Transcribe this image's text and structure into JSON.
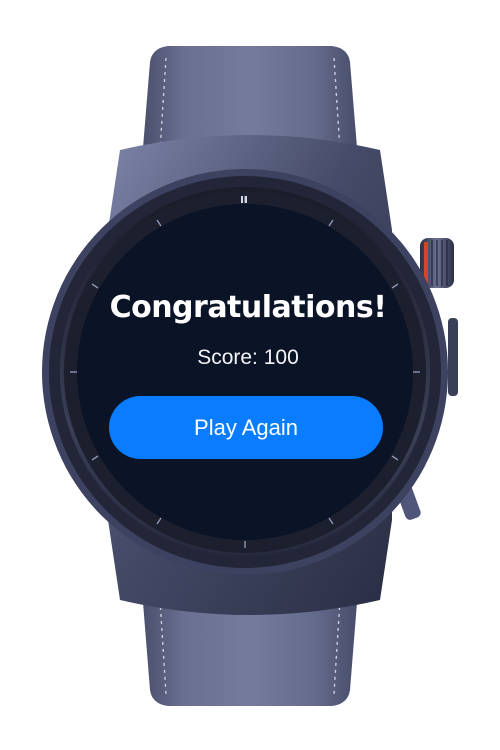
{
  "screen": {
    "title": "Congratulations!",
    "score_text": "Score: 100"
  },
  "actions": {
    "play_again_label": "Play Again"
  },
  "colors": {
    "screen_background": "#0b1326",
    "button_background": "#0a7cff",
    "strap": "#5f6484",
    "case": "#454b67",
    "crown_accent": "#d4452e"
  },
  "icons": {
    "device": "smartwatch-icon"
  }
}
